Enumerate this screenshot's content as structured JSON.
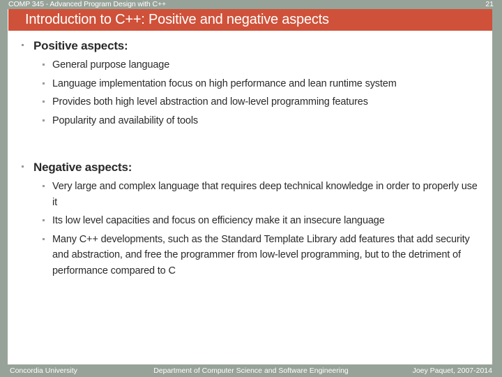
{
  "header": {
    "course": "COMP 345 - Advanced Program Design with C++",
    "page_number": "21"
  },
  "title": {
    "text": "Introduction to C++: Positive and negative aspects"
  },
  "colors": {
    "accent_red": "#cf5139",
    "rail_sage": "#97a399",
    "body_text": "#2a2a2a",
    "bullet_gray": "#9a9a9a",
    "background": "#ffffff"
  },
  "sections": [
    {
      "heading": "Positive aspects:",
      "items": [
        "General purpose language",
        "Language implementation focus on high performance and lean runtime system",
        "Provides both high level abstraction and low-level programming features",
        "Popularity and availability of tools"
      ]
    },
    {
      "heading": "Negative aspects:",
      "items": [
        "Very large and complex language that requires deep technical knowledge in order to properly use it",
        "Its low level capacities and focus on efficiency make it an insecure language",
        "Many C++ developments, such as the Standard Template Library add features that add security and abstraction, and free the programmer from low-level programming, but to the detriment of performance compared to C"
      ]
    }
  ],
  "footer": {
    "left": "Concordia University",
    "center": "Department of Computer Science and Software Engineering",
    "right": "Joey Paquet, 2007-2014"
  }
}
